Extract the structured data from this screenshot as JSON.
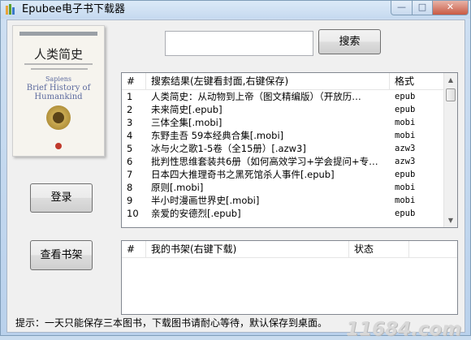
{
  "window": {
    "title": "Epubee电子书下载器",
    "controls": {
      "minimize": "—",
      "maximize": "□",
      "close": "✕"
    }
  },
  "cover": {
    "title": "人类简史",
    "subtitle_en": "Sapiens",
    "brief_line1": "Brief History of",
    "brief_line2": "Humankind"
  },
  "search": {
    "input_value": "",
    "button_label": "搜索"
  },
  "buttons": {
    "login": "登录",
    "shelf": "查看书架"
  },
  "results": {
    "headers": {
      "num": "#",
      "title": "搜索结果(左键看封面,右键保存)",
      "format": "格式"
    },
    "rows": [
      {
        "num": "1",
        "title": "人类简史：从动物到上帝（图文精编版）（开放历…",
        "format": "epub"
      },
      {
        "num": "2",
        "title": "未来简史[.epub]",
        "format": "epub"
      },
      {
        "num": "3",
        "title": "三体全集[.mobi]",
        "format": "mobi"
      },
      {
        "num": "4",
        "title": "东野圭吾 59本经典合集[.mobi]",
        "format": "mobi"
      },
      {
        "num": "5",
        "title": "冰与火之歌1-5卷（全15册）[.azw3]",
        "format": "azw3"
      },
      {
        "num": "6",
        "title": "批判性思维套装共6册（如何高效学习+学会提问+专…",
        "format": "azw3"
      },
      {
        "num": "7",
        "title": "日本四大推理奇书之黑死馆杀人事件[.epub]",
        "format": "epub"
      },
      {
        "num": "8",
        "title": "原则[.mobi]",
        "format": "mobi"
      },
      {
        "num": "9",
        "title": "半小时漫画世界史[.mobi]",
        "format": "mobi"
      },
      {
        "num": "10",
        "title": "亲爱的安德烈[.epub]",
        "format": "epub"
      }
    ]
  },
  "shelf": {
    "headers": {
      "num": "#",
      "title": "我的书架(右键下载)",
      "status": "状态"
    },
    "rows": []
  },
  "hint": "提示：一天只能保存三本图书，下载图书请耐心等待，默认保存到桌面。",
  "watermark": "11684.com"
}
